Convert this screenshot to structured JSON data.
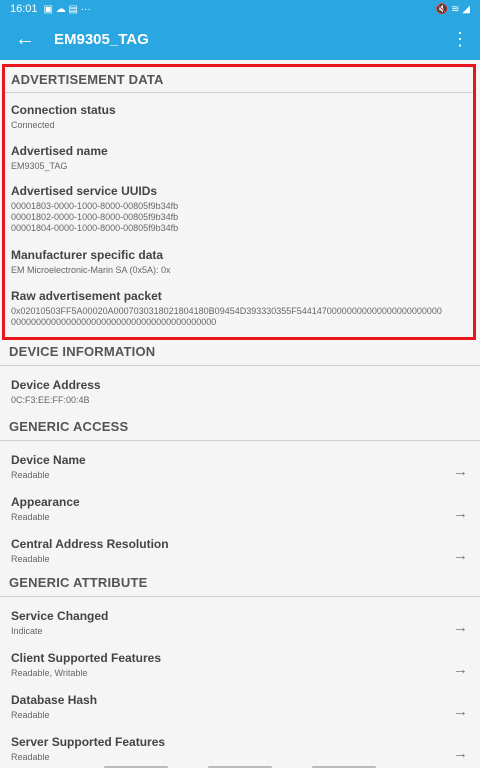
{
  "statusbar": {
    "time": "16:01",
    "icons_left": "▣ ☁ ▤ ···",
    "icons_right": "🔇 ≋ ◢"
  },
  "appbar": {
    "title": "EM9305_TAG",
    "back_icon": "arrow-back-icon",
    "more_icon": "more-vert-icon"
  },
  "advertisement": {
    "header": "ADVERTISEMENT DATA",
    "items": [
      {
        "title": "Connection status",
        "value": "Connected"
      },
      {
        "title": "Advertised name",
        "value": "EM9305_TAG"
      },
      {
        "title": "Advertised service UUIDs",
        "values": [
          "00001803-0000-1000-8000-00805f9b34fb",
          "00001802-0000-1000-8000-00805f9b34fb",
          "00001804-0000-1000-8000-00805f9b34fb"
        ]
      },
      {
        "title": "Manufacturer specific data",
        "value": "EM Microelectronic-Marin SA (0x5A): 0x"
      },
      {
        "title": "Raw advertisement packet",
        "values": [
          "0x02010503FF5A00020A0007030318021804180B09454D393330355F54414700000000000000000000000",
          "00000000000000000000000000000000000000000"
        ]
      }
    ]
  },
  "device_info": {
    "header": "DEVICE INFORMATION",
    "items": [
      {
        "title": "Device Address",
        "value": "0C:F3:EE:FF:00:4B"
      }
    ]
  },
  "generic_access": {
    "header": "GENERIC ACCESS",
    "items": [
      {
        "title": "Device Name",
        "value": "Readable"
      },
      {
        "title": "Appearance",
        "value": "Readable"
      },
      {
        "title": "Central Address Resolution",
        "value": "Readable"
      }
    ]
  },
  "generic_attribute": {
    "header": "GENERIC ATTRIBUTE",
    "items": [
      {
        "title": "Service Changed",
        "value": "Indicate"
      },
      {
        "title": "Client Supported Features",
        "value": "Readable, Writable"
      },
      {
        "title": "Database Hash",
        "value": "Readable"
      },
      {
        "title": "Server Supported Features",
        "value": "Readable"
      }
    ]
  },
  "arrow_glyph": "→"
}
